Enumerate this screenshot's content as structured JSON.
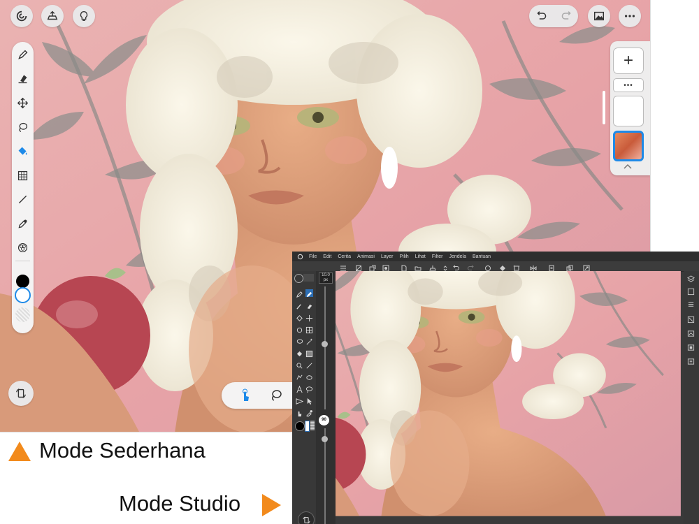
{
  "simple_mode": {
    "top_left_buttons": [
      {
        "name": "app-logo-icon"
      },
      {
        "name": "export-icon"
      },
      {
        "name": "lightbulb-icon"
      }
    ],
    "top_right_buttons": [
      {
        "name": "undo-icon"
      },
      {
        "name": "redo-icon"
      },
      {
        "name": "gallery-icon"
      },
      {
        "name": "more-icon"
      }
    ],
    "tools": [
      "pen-icon",
      "eraser-icon",
      "move-icon",
      "lasso-icon",
      "fill-icon",
      "transform-grid-icon",
      "line-icon",
      "eyedropper-icon",
      "color-wheel-icon"
    ],
    "primary_color": "#000000",
    "secondary_color": "#ffffff",
    "layer_panel": {
      "add_label": "+",
      "more_label": "•••"
    },
    "bottom_tools": [
      "touch-hand-icon",
      "lasso-icon"
    ],
    "mode_switch": "mode-switch-icon"
  },
  "studio_mode": {
    "menu": [
      "File",
      "Edit",
      "Cerita",
      "Animasi",
      "Layer",
      "Pilih",
      "Lihat",
      "Filter",
      "Jendela",
      "Bantuan"
    ],
    "brush_size": "10.0",
    "brush_size_unit": "px",
    "opacity": "90"
  },
  "captions": {
    "simple": "Mode Sederhana",
    "studio": "Mode Studio"
  },
  "colors": {
    "accent_orange": "#f28a1c",
    "accent_blue": "#1e8ae8",
    "canvas_pink": "#e8a9ab"
  }
}
